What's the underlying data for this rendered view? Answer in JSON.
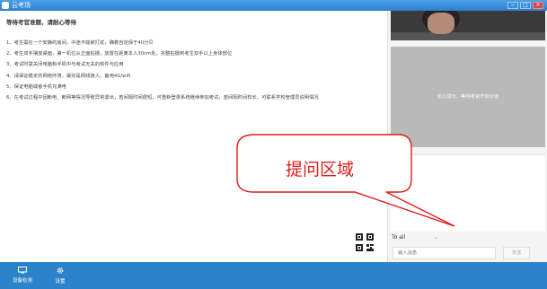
{
  "window": {
    "title": "云考场",
    "controls": [
      "−",
      "□",
      "×"
    ]
  },
  "instructions": {
    "title": "等待考官准题，请耐心等待",
    "items": [
      "1、考生需在一个安静的房间，中途不能被打扰，确着自定保于40分贝",
      "2、考生双手摆放桌面，第一机位从正面拍摄，放置在距离本人30cm处，完整拍摄到考生双手以上身体部位",
      "3、考试时需关闭电脑和手机中与考试无关的软件与应用",
      "4、请保证稳定的网络环境，最好是网线接入，备用4G/wifi",
      "5、保证电脑或者手机充满电",
      "6、在考试过程中因断电、断网等情况导致异常退出，若间隔时间很短，可重新登录系统继续参加考试，若间隔时间较长，可联系学校管理员说明情况"
    ]
  },
  "video_panel": {
    "waiting_text": "加入成功，等待考官开启对话"
  },
  "chat": {
    "to_label": "To",
    "recipient": "all",
    "input_placeholder": "输入消息",
    "send_label": "发送"
  },
  "annotation": {
    "text": "提问区域",
    "color": "#e01c1c"
  },
  "bottom_bar": {
    "items": [
      {
        "label": "设备检测",
        "icon": "monitor-icon"
      },
      {
        "label": "设置",
        "icon": "gear-icon"
      }
    ]
  },
  "colors": {
    "titlebar": "#2c7fd1",
    "bottom_bar": "#2b84c9",
    "annotation": "#e01c1c"
  }
}
